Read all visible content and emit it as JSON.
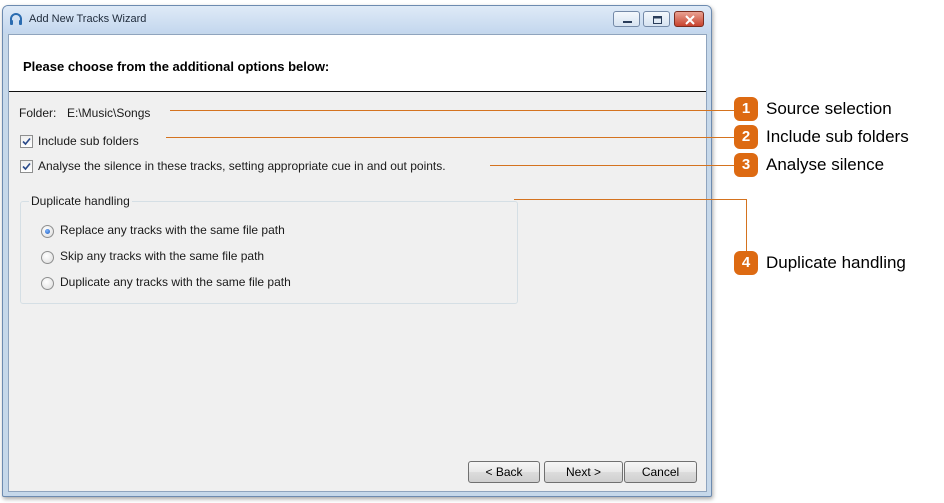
{
  "window": {
    "title": "Add New Tracks Wizard"
  },
  "header": {
    "text": "Please choose from the additional options below:"
  },
  "folder": {
    "label": "Folder:",
    "path": "E:\\Music\\Songs"
  },
  "options": {
    "include_sub_folders": {
      "label": "Include sub folders",
      "checked": true
    },
    "analyse_silence": {
      "label": "Analyse the silence in these tracks, setting appropriate cue in and out points.",
      "checked": true
    }
  },
  "duplicate_handling": {
    "title": "Duplicate handling",
    "options": [
      {
        "label": "Replace any tracks with the same file path",
        "selected": true
      },
      {
        "label": "Skip any tracks with the same file path",
        "selected": false
      },
      {
        "label": "Duplicate any tracks with the same file path",
        "selected": false
      }
    ]
  },
  "buttons": {
    "back": "< Back",
    "next": "Next >",
    "cancel": "Cancel"
  },
  "callouts": [
    {
      "number": "1",
      "label": "Source selection"
    },
    {
      "number": "2",
      "label": "Include sub folders"
    },
    {
      "number": "3",
      "label": "Analyse silence"
    },
    {
      "number": "4",
      "label": "Duplicate handling"
    }
  ],
  "colors": {
    "callout_accent": "#dd6a12",
    "titlebar": "#c4d7ee",
    "dialog_background": "#f0f0f0"
  }
}
